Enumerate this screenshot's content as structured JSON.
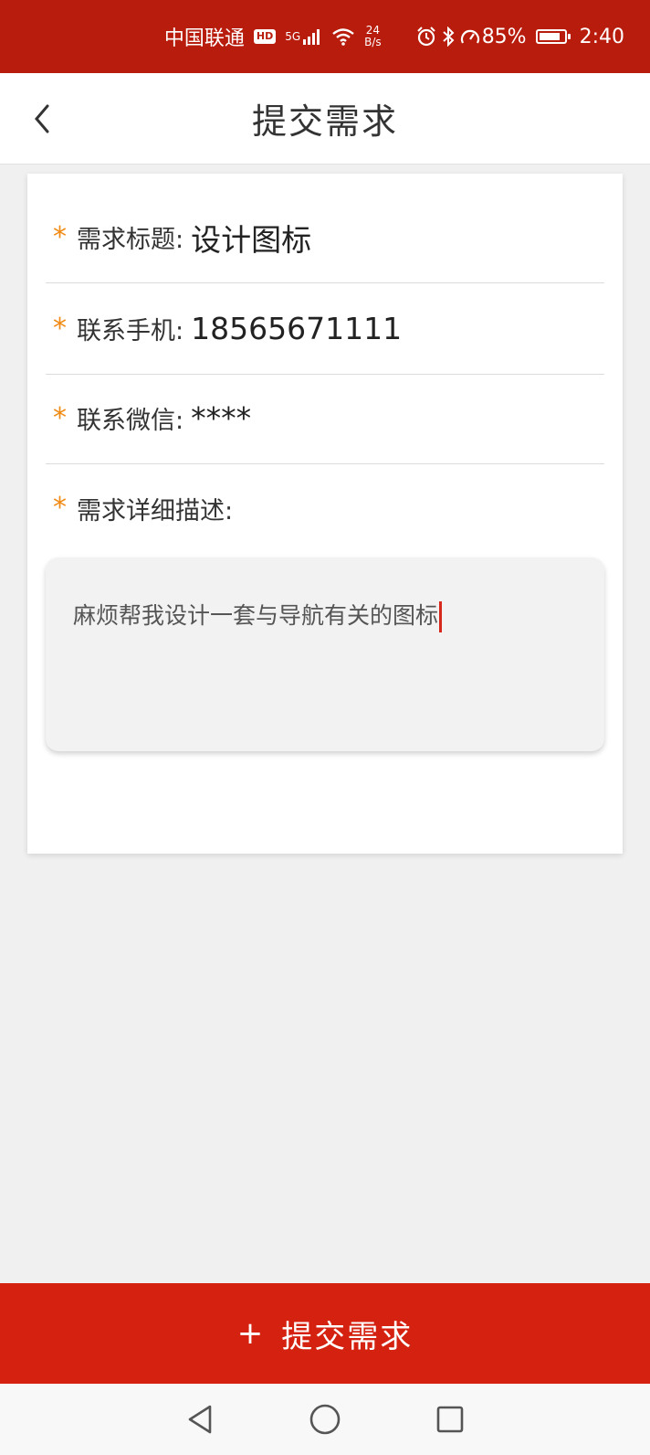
{
  "status_bar": {
    "carrier": "中国联通",
    "hd": "HD",
    "signal_type": "5G",
    "net_speed_value": "24",
    "net_speed_unit": "B/s",
    "battery_percent": "85%",
    "time": "2:40"
  },
  "header": {
    "title": "提交需求"
  },
  "form": {
    "required_mark": "*",
    "title_label": "需求标题:",
    "title_value": "设计图标",
    "phone_label": "联系手机:",
    "phone_value": "18565671111",
    "wechat_label": "联系微信:",
    "wechat_value": "****",
    "description_label": "需求详细描述:",
    "description_value": "麻烦帮我设计一套与导航有关的图标"
  },
  "submit": {
    "icon": "+",
    "label": "提交需求"
  },
  "colors": {
    "status_bar": "#b81c0c",
    "accent": "#d5210f",
    "required_star": "#f08a13"
  },
  "icons": {
    "back": "chevron-left-icon",
    "alarm": "alarm-icon",
    "bluetooth": "bluetooth-icon",
    "wifi": "wifi-icon",
    "signal": "signal-icon",
    "battery": "battery-icon",
    "nav_back": "triangle-back-icon",
    "nav_home": "circle-home-icon",
    "nav_recent": "square-recent-icon"
  }
}
